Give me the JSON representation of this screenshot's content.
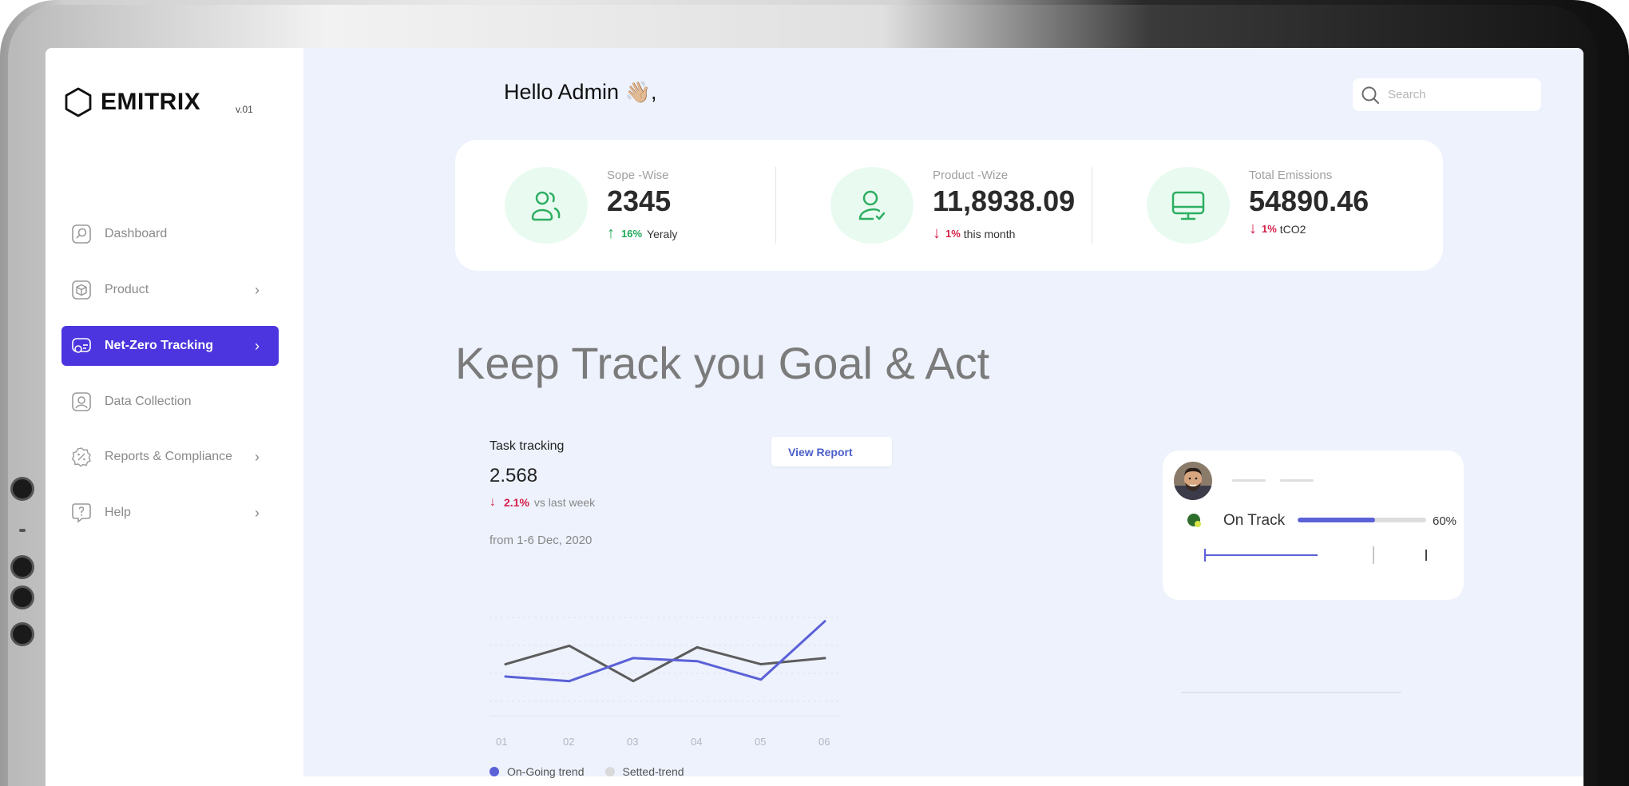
{
  "app": {
    "name": "EMITRIX",
    "version": "v.01"
  },
  "sidebar": {
    "items": [
      {
        "label": "Dashboard",
        "icon": "dashboard-icon",
        "chevron": false,
        "active": false
      },
      {
        "label": "Product",
        "icon": "cube-icon",
        "chevron": true,
        "active": false
      },
      {
        "label": "Net-Zero Tracking",
        "icon": "net-zero-icon",
        "chevron": true,
        "active": true
      },
      {
        "label": "Data Collection",
        "icon": "user-square-icon",
        "chevron": false,
        "active": false
      },
      {
        "label": "Reports & Compliance",
        "icon": "badge-percent-icon",
        "chevron": true,
        "active": false
      },
      {
        "label": "Help",
        "icon": "help-bubble-icon",
        "chevron": true,
        "active": false
      }
    ]
  },
  "header": {
    "greeting": "Hello Admin",
    "greeting_emoji": "👋🏼",
    "greeting_suffix": ",",
    "search_placeholder": "Search"
  },
  "stats": [
    {
      "label": "Sope -Wise",
      "value": "2345",
      "change_pct": "16%",
      "change_label": "Yeraly",
      "direction": "up",
      "icon": "users-icon"
    },
    {
      "label": "Product -Wize",
      "value": "11,8938.09",
      "change_pct": "1%",
      "change_label": "this month",
      "direction": "down",
      "icon": "user-check-icon"
    },
    {
      "label": "Total Emissions",
      "value": "54890.46",
      "change_pct": "1%",
      "change_label": "tCO2",
      "direction": "down",
      "icon": "monitor-icon"
    }
  ],
  "headline": "Keep Track you Goal & Act",
  "task_tracking": {
    "title": "Task tracking",
    "value": "2.568",
    "change_pct": "2.1%",
    "change_label": "vs last week",
    "range": "from 1-6 Dec, 2020",
    "button_label": "View Report"
  },
  "chart_data": {
    "type": "line",
    "x": [
      "01",
      "02",
      "03",
      "04",
      "05",
      "06"
    ],
    "series": [
      {
        "name": "On-Going trend",
        "color": "#5b61d6",
        "values": [
          0.6,
          0.45,
          1.2,
          1.1,
          0.5,
          2.4
        ]
      },
      {
        "name": "Setted-trend",
        "color": "#5c5c5c",
        "values": [
          1.0,
          1.6,
          0.45,
          1.55,
          1.0,
          1.2
        ]
      }
    ],
    "ylim": [
      0,
      2.6
    ],
    "grid": true,
    "legend_position": "bottom-left",
    "legend": [
      {
        "label": "On-Going trend",
        "color": "#5b61d6"
      },
      {
        "label": "Setted-trend",
        "color": "#d9d9d9"
      }
    ]
  },
  "status_card": {
    "label": "On Track",
    "progress": 0.6,
    "progress_label": "60%"
  },
  "colors": {
    "accent": "#4c35de",
    "main_bg": "#edf2fd",
    "stat_icon_bg": "#e9fbf0",
    "green": "#1faa59",
    "red": "#d61f4a"
  }
}
